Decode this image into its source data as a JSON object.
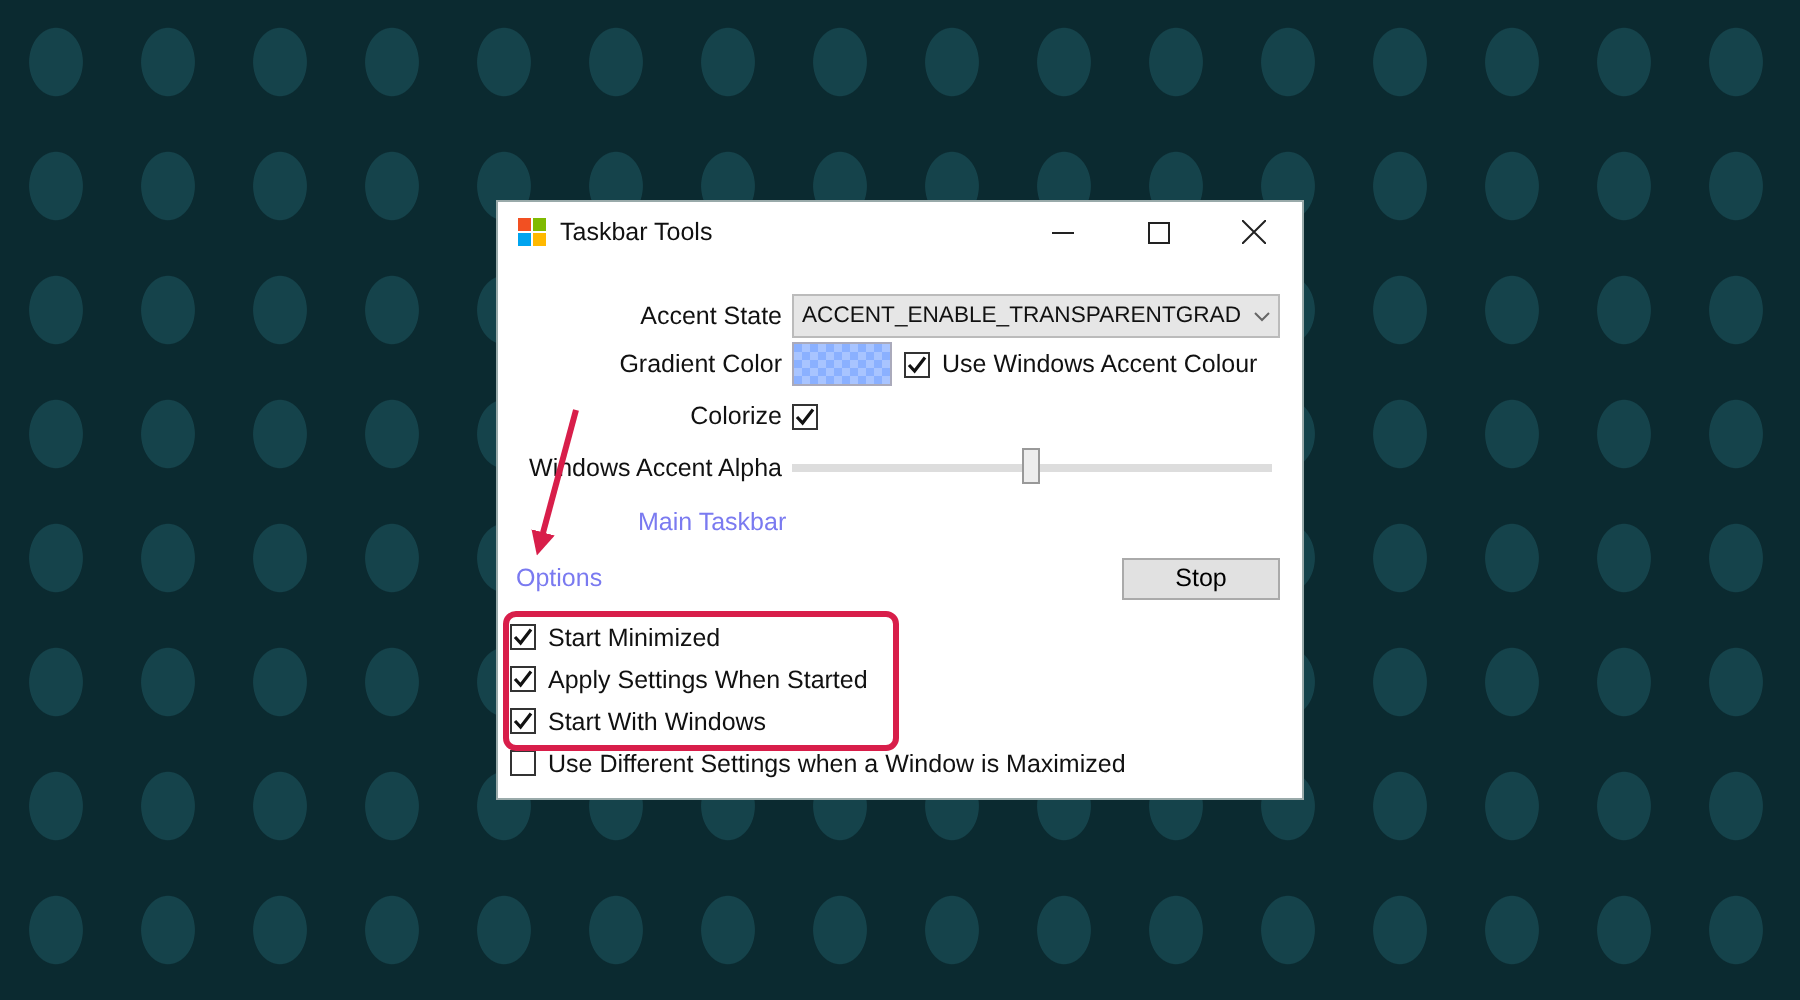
{
  "window": {
    "title": "Taskbar Tools"
  },
  "accent_state": {
    "label": "Accent State",
    "value": "ACCENT_ENABLE_TRANSPARENTGRAD"
  },
  "gradient_color": {
    "label": "Gradient Color",
    "use_accent": {
      "label": "Use Windows Accent Colour",
      "checked": true
    }
  },
  "colorize": {
    "label": "Colorize",
    "checked": true
  },
  "alpha": {
    "label": "Windows Accent Alpha",
    "level": 0.5
  },
  "main_taskbar_link": "Main Taskbar",
  "options_link": "Options",
  "stop_button": "Stop",
  "options": [
    {
      "label": "Start Minimized",
      "checked": true
    },
    {
      "label": "Apply Settings When Started",
      "checked": true
    },
    {
      "label": "Start With Windows",
      "checked": true
    },
    {
      "label": "Use Different Settings when a Window is Maximized",
      "checked": false
    }
  ]
}
